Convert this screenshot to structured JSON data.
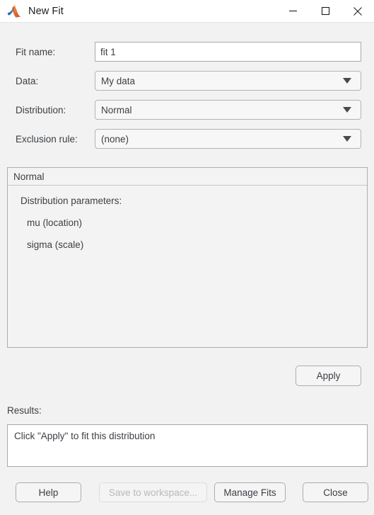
{
  "window": {
    "title": "New Fit",
    "app_icon": "matlab-membrane-icon",
    "controls": {
      "minimize": "minimize-icon",
      "maximize": "maximize-icon",
      "close": "close-icon"
    }
  },
  "form": {
    "fit_name": {
      "label": "Fit name:",
      "value": "fit 1",
      "placeholder": ""
    },
    "data": {
      "label": "Data:",
      "value": "My data"
    },
    "distribution": {
      "label": "Distribution:",
      "value": "Normal"
    },
    "exclusion_rule": {
      "label": "Exclusion rule:",
      "value": "(none)"
    }
  },
  "distribution_panel": {
    "header": "Normal",
    "parameters_label": "Distribution parameters:",
    "parameters": [
      "mu (location)",
      "sigma (scale)"
    ]
  },
  "apply": {
    "label": "Apply"
  },
  "results": {
    "label": "Results:",
    "text": "Click \"Apply\" to fit this distribution"
  },
  "footer": {
    "help": "Help",
    "save_to_workspace": "Save to workspace...",
    "manage_fits": "Manage Fits",
    "close": "Close"
  },
  "colors": {
    "window_background": "#f2f2f2",
    "titlebar_background": "#ffffff",
    "field_background": "#ffffff",
    "border": "#a9a9a9",
    "text": "#3b3f44",
    "disabled_text": "#b9b9b9"
  }
}
